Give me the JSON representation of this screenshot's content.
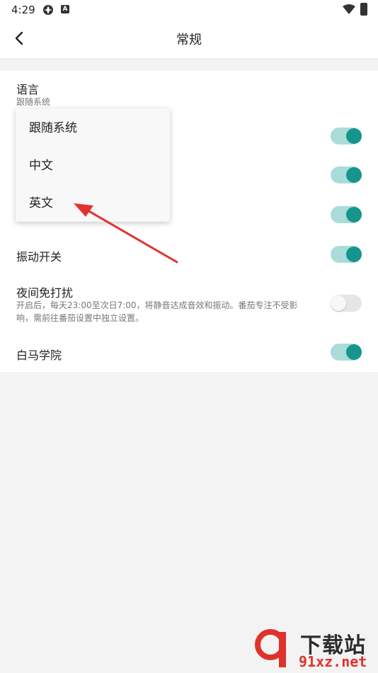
{
  "status_bar": {
    "time": "4:29",
    "icon_left_1": "app-notification-icon",
    "icon_left_2_letter": "A",
    "icon_right_1": "wifi-icon",
    "icon_right_2": "battery-icon"
  },
  "app_bar": {
    "title": "常规",
    "back_icon": "back-arrow-icon"
  },
  "settings": {
    "language": {
      "title": "语言",
      "subtitle": "跟随系统"
    },
    "vibration": {
      "title": "振动开关",
      "toggle_on": true
    },
    "night_dnd": {
      "title": "夜间免打扰",
      "subtitle_line1": "开启后，每天23:00至次日7:00，将静音达成音效和振动。番茄专注不受影",
      "subtitle_line2": "响，需前往番茄设置中独立设置。",
      "toggle_on": false
    },
    "baima": {
      "title": "白马学院",
      "toggle_on": true
    },
    "hidden_toggles_on": [
      true,
      true,
      true
    ]
  },
  "language_popup": {
    "options": [
      "跟随系统",
      "中文",
      "英文"
    ]
  },
  "colors": {
    "accent": "#16958d",
    "accent_track": "#a9dcd9",
    "arrow": "#e0322d"
  },
  "watermark": {
    "title": "下载站",
    "url": "91xz.net"
  }
}
